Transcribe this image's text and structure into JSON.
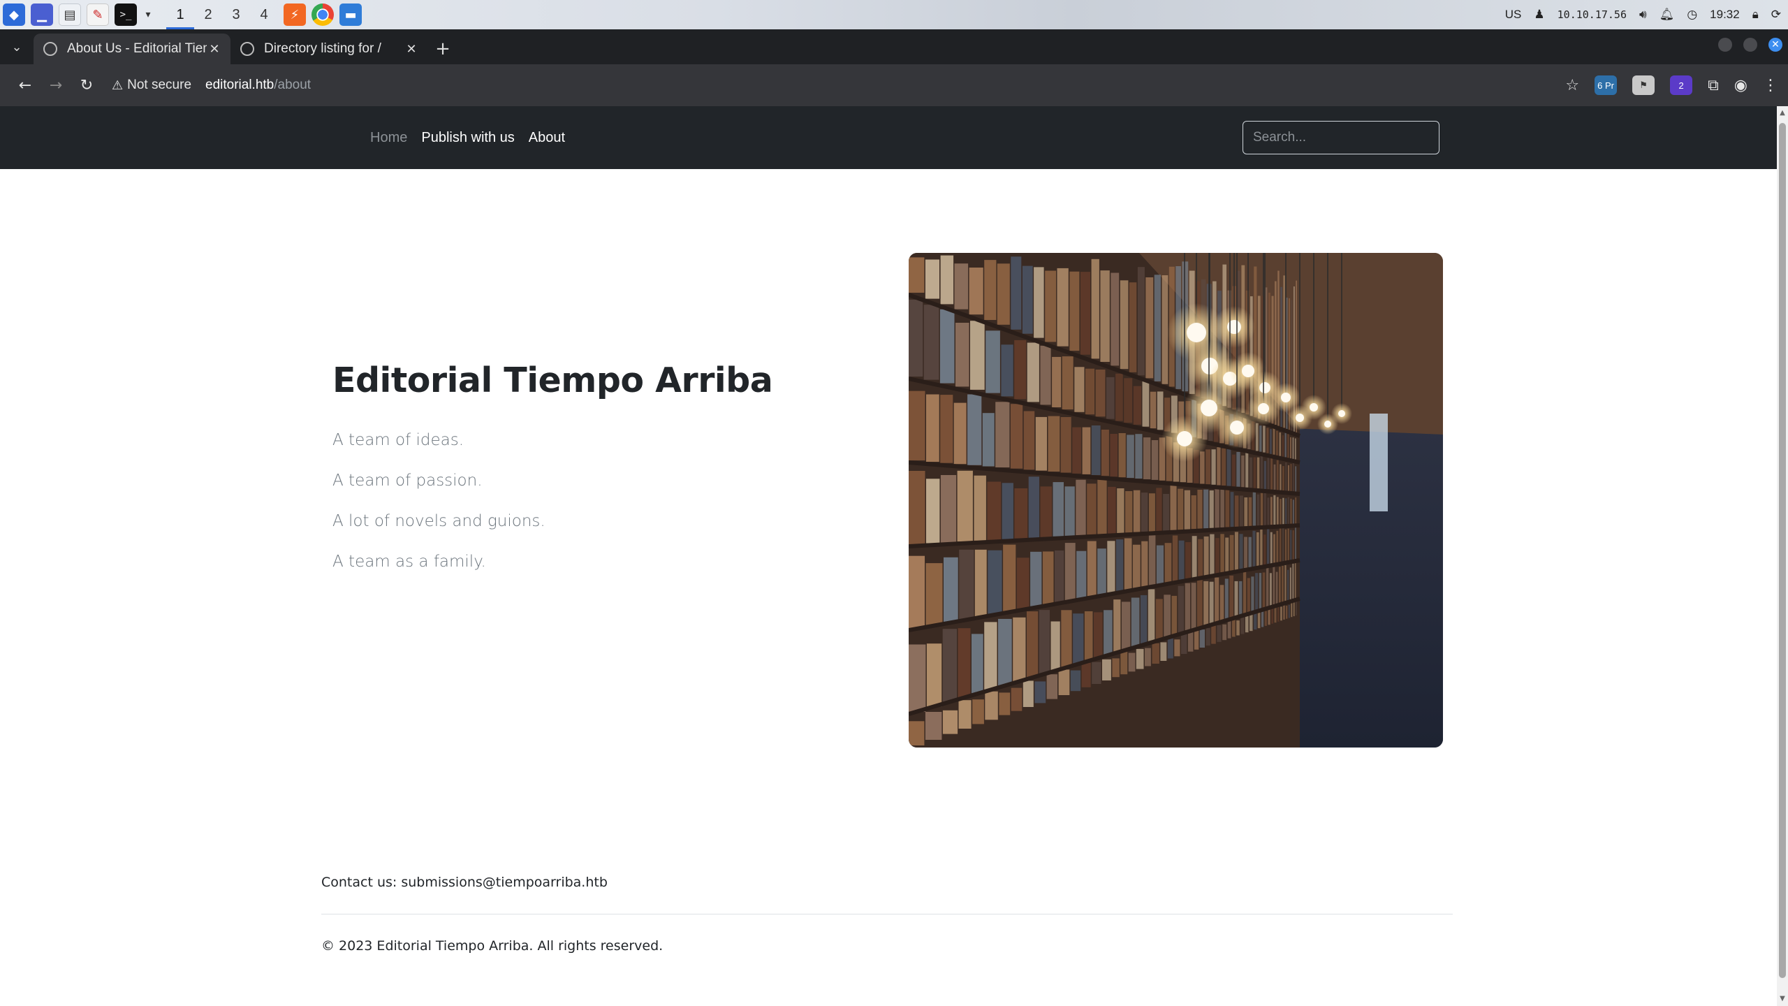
{
  "os_taskbar": {
    "workspaces": [
      "1",
      "2",
      "3",
      "4"
    ],
    "active_workspace": "1",
    "keyboard_layout": "US",
    "ip_address": "10.10.17.56",
    "clock": "19:32"
  },
  "browser": {
    "tabs": [
      {
        "title": "About Us - Editorial Tiem",
        "active": true
      },
      {
        "title": "Directory listing for /",
        "active": false
      }
    ],
    "security_label": "Not secure",
    "url_host": "editorial.htb",
    "url_path": "/about",
    "extension_badges": {
      "proxy": "6 Pr",
      "wappalyzer": "2"
    }
  },
  "site": {
    "nav": {
      "home": "Home",
      "publish": "Publish with us",
      "about": "About",
      "search_placeholder": "Search..."
    },
    "hero": {
      "title": "Editorial Tiempo Arriba",
      "lines": [
        "A team of ideas.",
        "A team of passion.",
        "A lot of novels and guions.",
        "A team as a family."
      ]
    },
    "footer": {
      "contact": "Contact us: submissions@tiempoarriba.htb",
      "copyright": "© 2023 Editorial Tiempo Arriba. All rights reserved."
    }
  },
  "colors": {
    "navbar_bg": "#212529",
    "browser_chrome": "#35363a",
    "tabstrip": "#1f2124",
    "accent": "#2d6bd8"
  }
}
